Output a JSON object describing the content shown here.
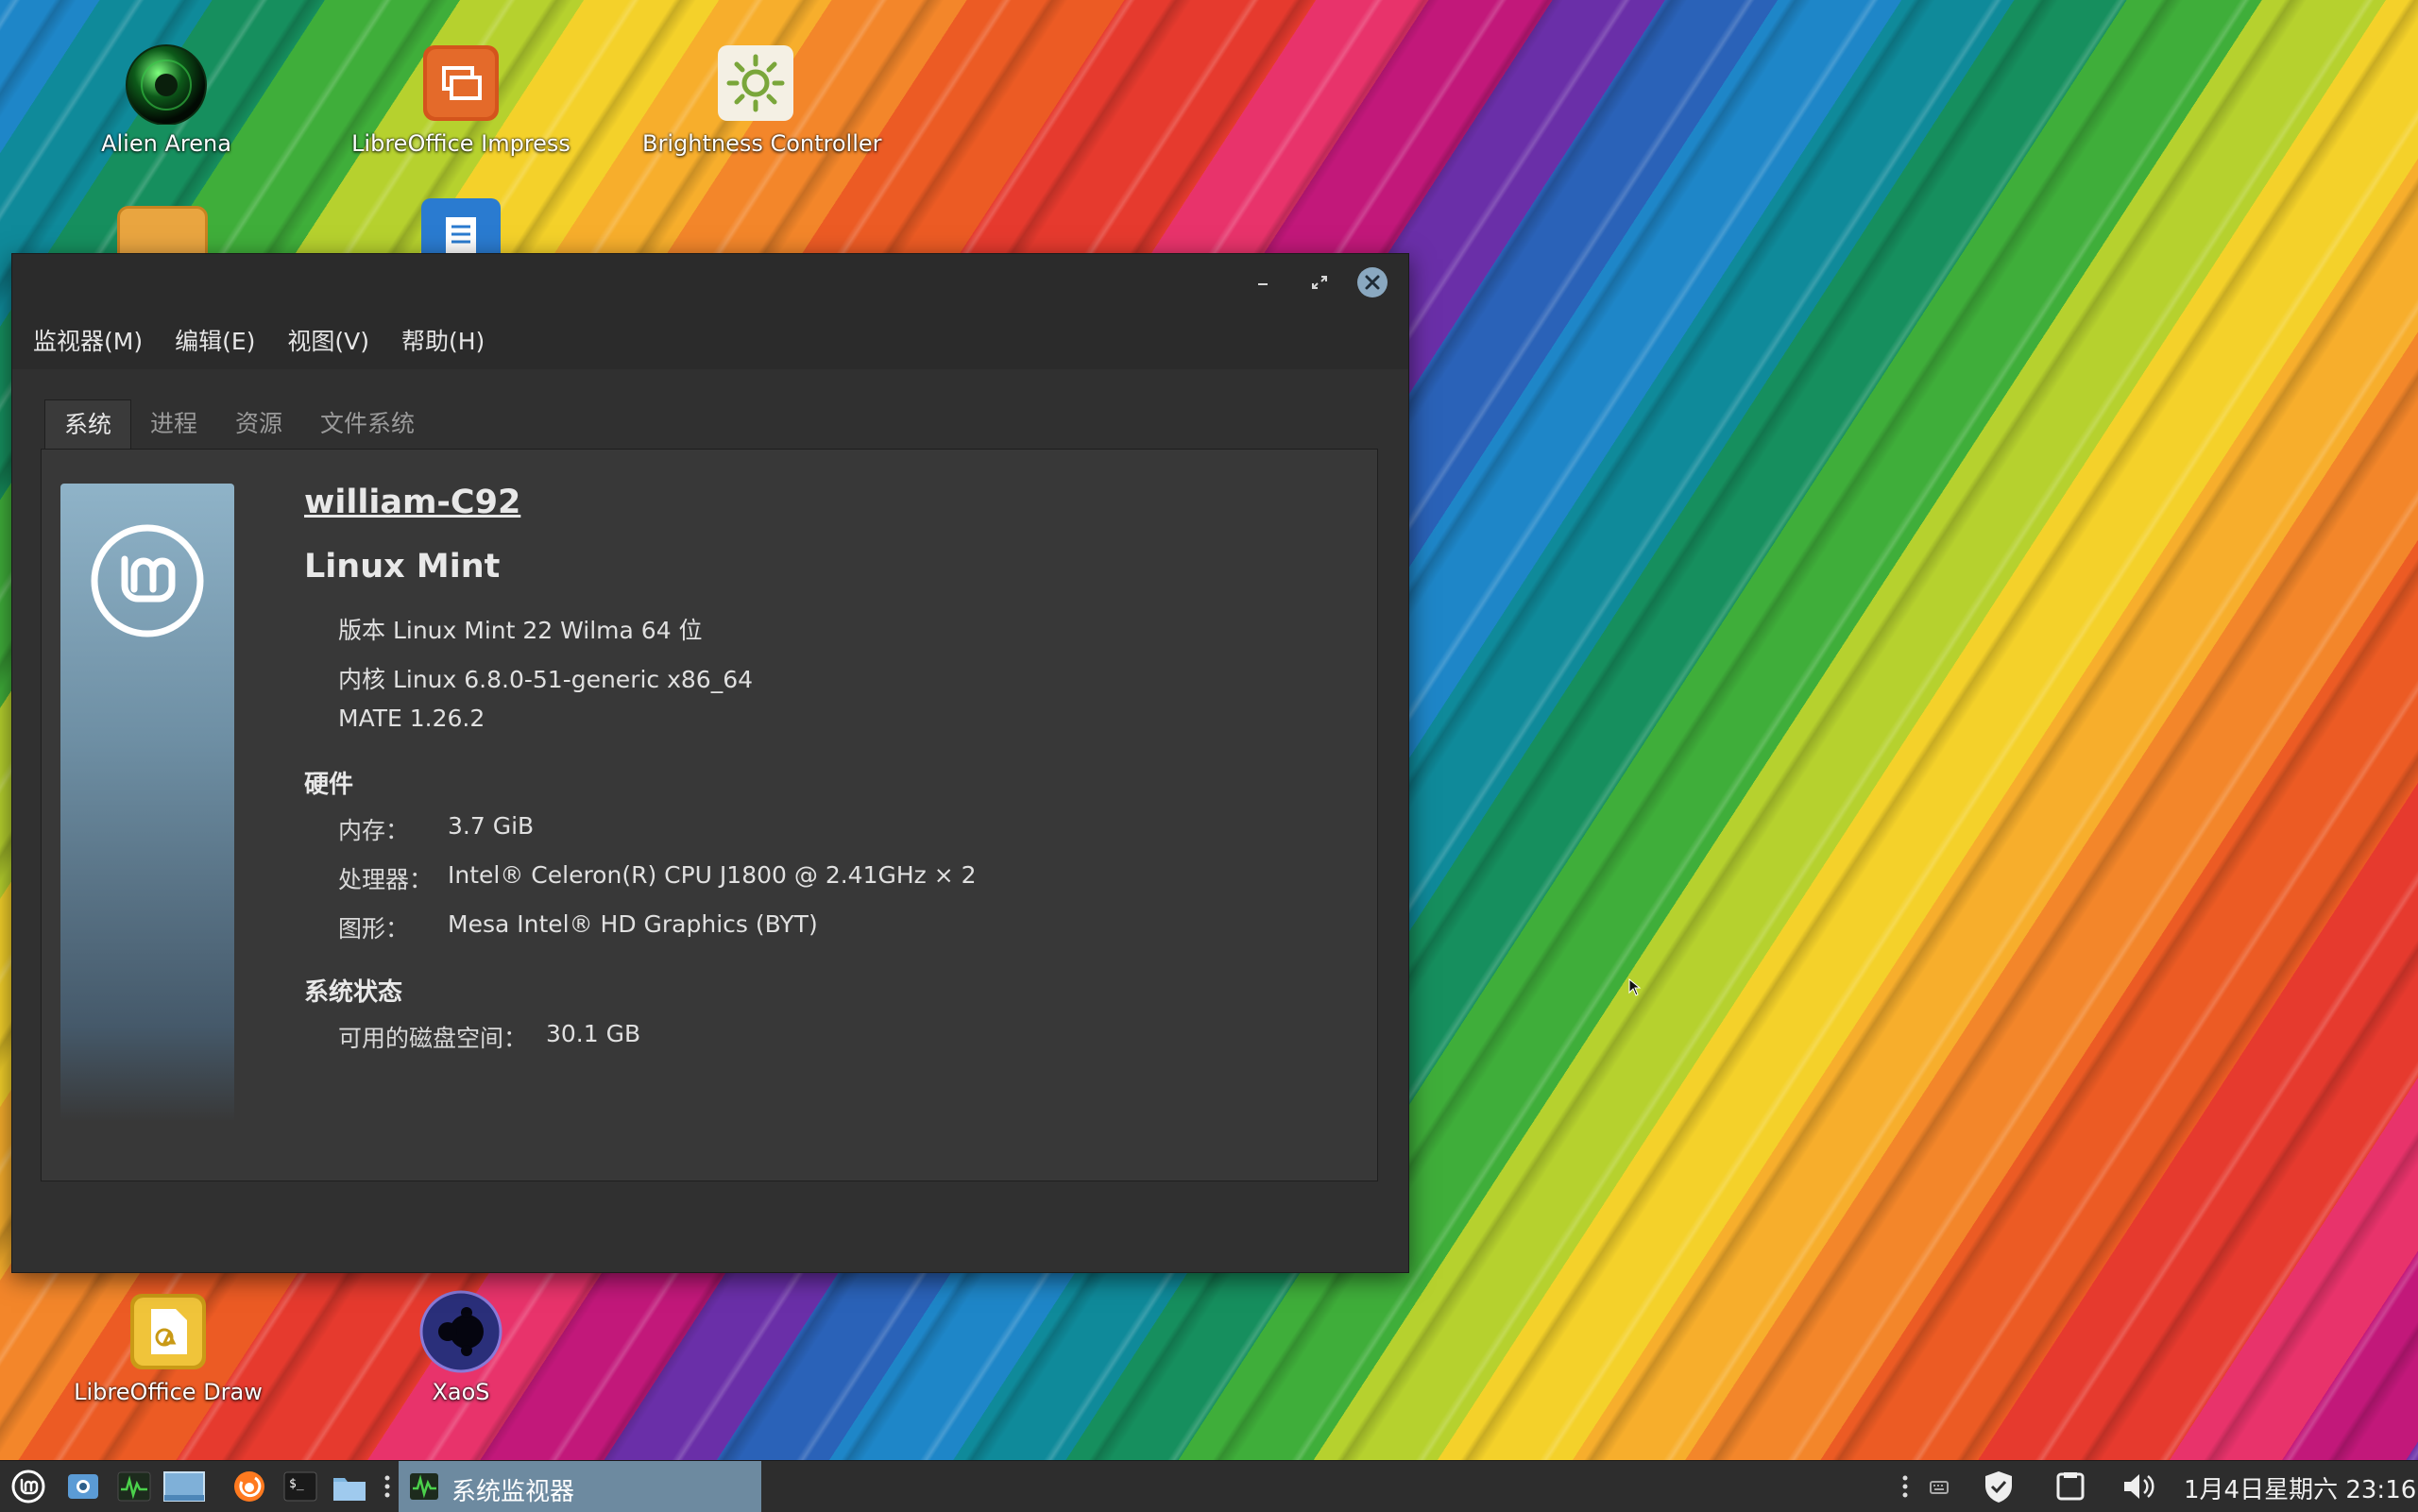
{
  "desktop": {
    "icons": [
      {
        "label": "Alien Arena",
        "icon": "alien-arena-icon"
      },
      {
        "label": "LibreOffice Impress",
        "icon": "libreoffice-impress-icon"
      },
      {
        "label": "Brightness Controller",
        "icon": "brightness-icon"
      },
      {
        "label": "LibreOffice Draw",
        "icon": "libreoffice-draw-icon"
      },
      {
        "label": "XaoS",
        "icon": "xaos-fractal-icon"
      }
    ]
  },
  "window": {
    "menu": [
      "监视器(M)",
      "编辑(E)",
      "视图(V)",
      "帮助(H)"
    ],
    "tabs": [
      "系统",
      "进程",
      "资源",
      "文件系统"
    ],
    "active_tab": "系统",
    "system": {
      "hostname": "william-C92",
      "distro": "Linux Mint",
      "version": "版本 Linux Mint 22 Wilma 64 位",
      "kernel": "内核 Linux 6.8.0-51-generic x86_64",
      "desktop_env": "MATE 1.26.2",
      "hardware_heading": "硬件",
      "memory_label": "内存：",
      "memory_value": "3.7 GiB",
      "cpu_label": "处理器：",
      "cpu_value": "Intel® Celeron(R) CPU J1800 @ 2.41GHz × 2",
      "graphics_label": "图形：",
      "graphics_value": "Mesa Intel® HD Graphics (BYT)",
      "status_heading": "系统状态",
      "disk_label": "可用的磁盘空间：",
      "disk_value": "30.1 GB"
    }
  },
  "taskbar": {
    "active_task": "系统监视器",
    "clock": "1月4日星期六 23:16"
  },
  "colors": {
    "window_bg": "#2f2f2f",
    "panel_bg": "#383838",
    "taskbar_bg": "#2d2d2d",
    "active_task_bg": "#6d8aa0",
    "close_button": "#8aa8c0"
  }
}
